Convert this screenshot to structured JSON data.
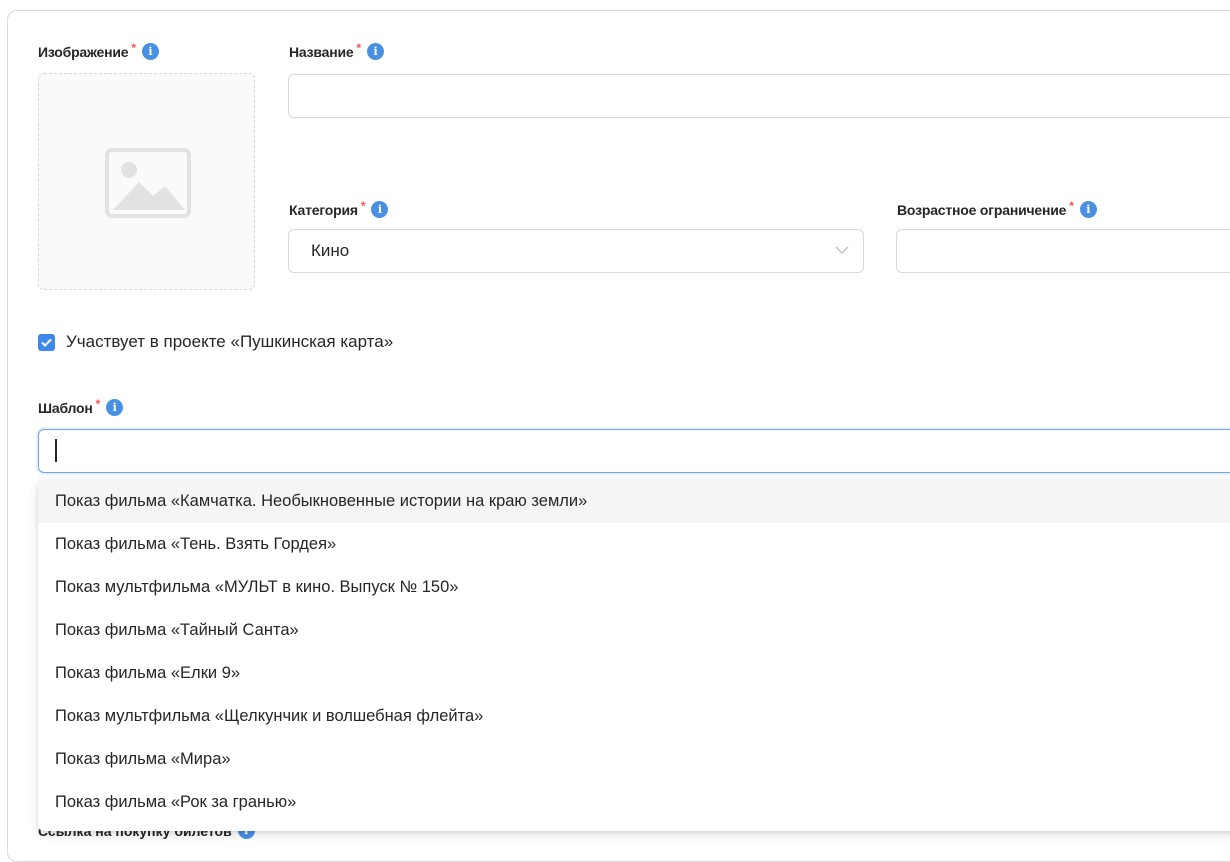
{
  "form": {
    "image": {
      "label": "Изображение",
      "required": "*",
      "info": "i",
      "placeholder_icon": "image-placeholder-icon"
    },
    "title": {
      "label": "Название",
      "required": "*",
      "info": "i",
      "value": ""
    },
    "category": {
      "label": "Категория",
      "required": "*",
      "info": "i",
      "value": "Кино"
    },
    "age_limit": {
      "label": "Возрастное ограничение",
      "required": "*",
      "info": "i",
      "value": ""
    },
    "pushkin": {
      "label": "Участвует в проекте «Пушкинская карта»",
      "checked": true
    },
    "template": {
      "label": "Шаблон",
      "required": "*",
      "info": "i",
      "value": "",
      "options": [
        "Показ фильма «Камчатка. Необыкновенные истории на краю земли»",
        "Показ фильма «Тень. Взять Гордея»",
        "Показ мультфильма «МУЛЬТ в кино. Выпуск № 150»",
        "Показ фильма «Тайный Санта»",
        "Показ фильма «Елки 9»",
        "Показ мультфильма «Щелкунчик и волшебная флейта»",
        "Показ фильма «Мира»",
        "Показ фильма «Рок за гранью»"
      ]
    }
  },
  "colors": {
    "accent": "#3f88e8",
    "info": "#4a90e2",
    "required": "#ff4d4f",
    "hover": "#f5f5f5",
    "border": "#d9d9d9"
  }
}
